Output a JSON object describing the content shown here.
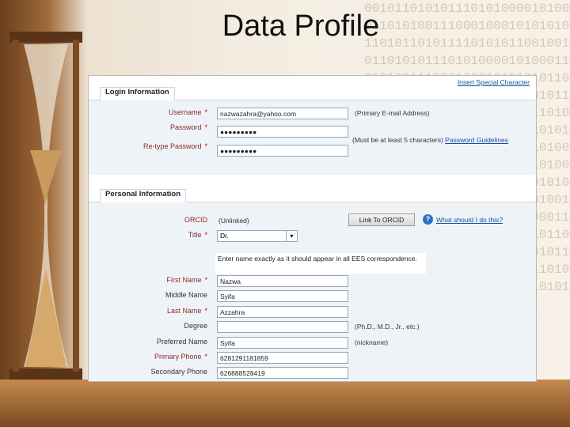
{
  "slide": {
    "title": "Data Profile"
  },
  "background_binary": "0010110101011101010000101000110101001110001000101010101101011010111101010110010010110101011101010000101000110101001110001000101010101101011010111101010110010010110101011101010000101000110101001110001000101010101101011010111101010110011010101001010110101011101010000101000110101001110001000101010101101011010111101010110010010110101011101010000101000110101001110001000101010101101011010111101010110010010110101011101010000101000110101001110001000101010101101011010111101010110011",
  "form": {
    "top_link": "Insert Special Character",
    "login": {
      "tab": "Login Information",
      "username_label": "Username",
      "username_value": "nazwazahra@yahoo.com",
      "username_note": "(Primary E-mail Address)",
      "password_label": "Password",
      "password_value": "●●●●●●●●●",
      "retype_label": "Re-type Password",
      "retype_value": "●●●●●●●●●",
      "password_note": "(Must be at least 5 characters)",
      "password_link": "Password Guidelines"
    },
    "personal": {
      "tab": "Personal Information",
      "orcid_label": "ORCID",
      "orcid_value": "(Unlinked)",
      "orcid_button": "Link To ORCID",
      "orcid_help_link": "What should I do this?",
      "title_label": "Title",
      "title_value": "Dr.",
      "info_text": "Enter name exactly as it should appear in all EES correspondence.",
      "first_name_label": "First Name",
      "first_name_value": "Nazwa",
      "middle_name_label": "Middle Name",
      "middle_name_value": "Syifa",
      "last_name_label": "Last Name",
      "last_name_value": "Azzahra",
      "degree_label": "Degree",
      "degree_value": "",
      "degree_note": "(Ph.D., M.D., Jr., etc.)",
      "preferred_label": "Preferred Name",
      "preferred_value": "Syifa",
      "preferred_note": "(nickname)",
      "primary_phone_label": "Primary Phone",
      "primary_phone_value": "6281291181859",
      "secondary_phone_label": "Secondary Phone",
      "secondary_phone_value": "626888528419"
    },
    "required_mark": "*"
  }
}
